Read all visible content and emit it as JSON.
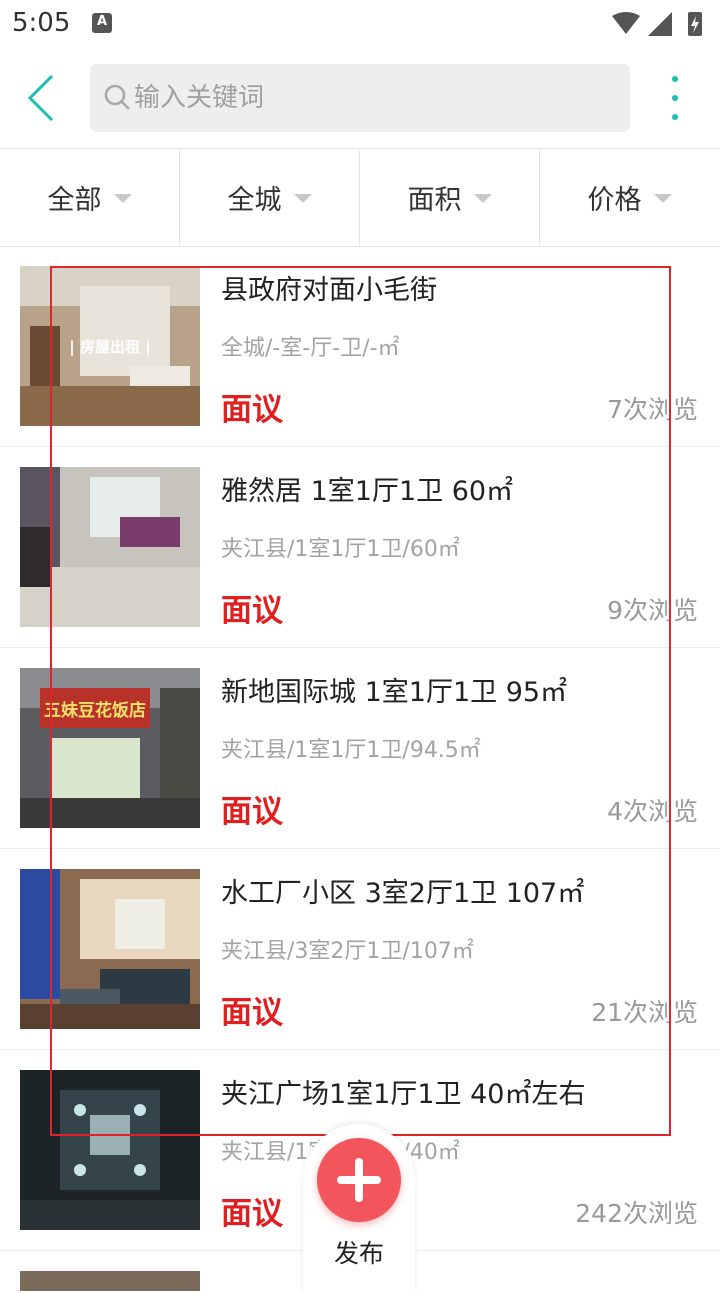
{
  "status_bar": {
    "time": "5:05",
    "a_badge": "A"
  },
  "search": {
    "placeholder": "输入关键词"
  },
  "filters": [
    {
      "label": "全部"
    },
    {
      "label": "全城"
    },
    {
      "label": "面积"
    },
    {
      "label": "价格"
    }
  ],
  "listings": [
    {
      "title": "县政府对面小毛街",
      "meta": "全城/-室-厅-卫/-㎡",
      "price": "面议",
      "views": "7次浏览",
      "thumb_text": "| 房屋出租 |"
    },
    {
      "title": "雅然居 1室1厅1卫 60㎡",
      "meta": "夹江县/1室1厅1卫/60㎡",
      "price": "面议",
      "views": "9次浏览"
    },
    {
      "title": "新地国际城 1室1厅1卫 95㎡",
      "meta": "夹江县/1室1厅1卫/94.5㎡",
      "price": "面议",
      "views": "4次浏览",
      "thumb_text": "五妹豆花饭店"
    },
    {
      "title": "水工厂小区 3室2厅1卫 107㎡",
      "meta": "夹江县/3室2厅1卫/107㎡",
      "price": "面议",
      "views": "21次浏览"
    },
    {
      "title": "夹江广场1室1厅1卫 40㎡左右",
      "meta": "夹江县/1室1厅1卫/40㎡",
      "price": "面议",
      "views": "242次浏览"
    }
  ],
  "fab": {
    "label": "发布"
  },
  "colors": {
    "accent": "#1bbfb1",
    "price": "#e02020",
    "fab": "#f2555b",
    "highlight": "#e0242c"
  }
}
